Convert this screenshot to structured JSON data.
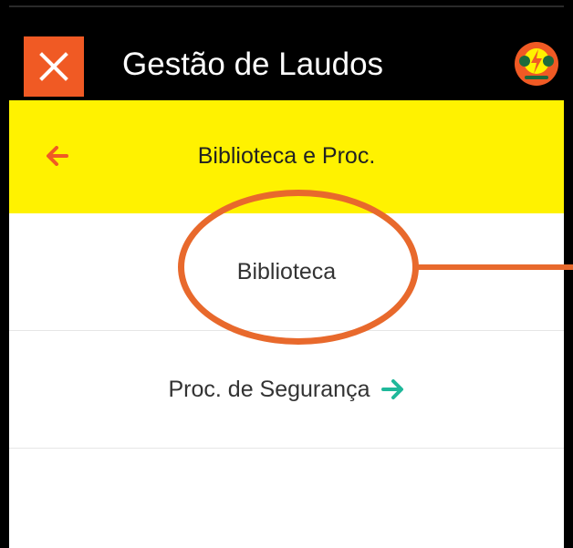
{
  "app": {
    "title": "Gestão de Laudos",
    "close_icon": "close-icon",
    "logo_icon": "company-logo"
  },
  "header": {
    "title": "Biblioteca e Proc.",
    "back_icon": "arrow-left-icon"
  },
  "menu": {
    "items": [
      {
        "label": "Biblioteca"
      },
      {
        "label": "Proc. de Segurança",
        "icon": "arrow-right-icon"
      }
    ]
  },
  "colors": {
    "topbar_bg": "#000000",
    "close_bg": "#f05a24",
    "header_bg": "#fff200",
    "back_arrow": "#f05a24",
    "forward_arrow": "#1fb89a",
    "annotation": "#e8692c"
  }
}
